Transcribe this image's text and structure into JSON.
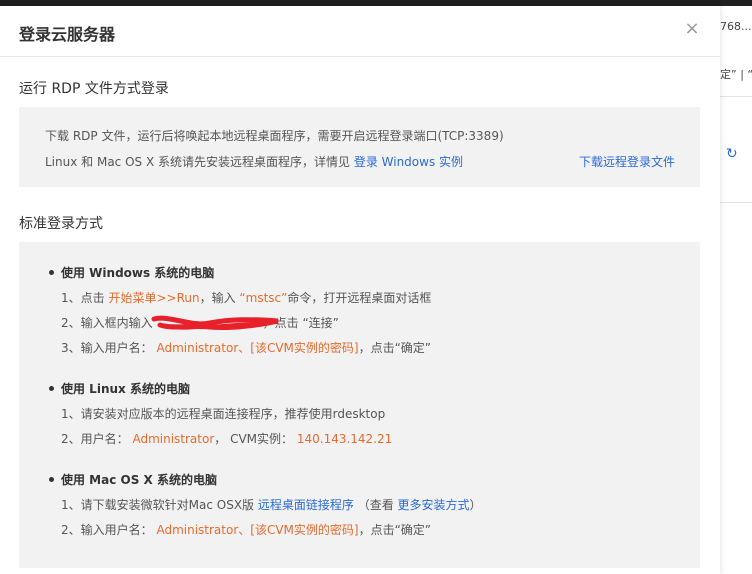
{
  "background": {
    "peek_top": "768...",
    "peek_mid": "定” | “失",
    "refresh_icon": "refresh-icon"
  },
  "modal": {
    "title": "登录云服务器",
    "close_label": "×"
  },
  "rdp": {
    "title": "运行 RDP 文件方式登录",
    "line1": "下载 RDP 文件，运行后将唤起本地远程桌面程序，需要开启远程登录端口(TCP:3389)",
    "line2_prefix": "Linux 和 Mac OS X 系统请先安装远程桌面程序，详情见 ",
    "line2_link": "登录 Windows 实例",
    "download_link": "下载远程登录文件"
  },
  "standard": {
    "title": "标准登录方式",
    "windows": {
      "head": "使用 Windows 系统的电脑",
      "s1_a": "1、点击 ",
      "s1_orange1": "开始菜单>>Run",
      "s1_b": "，输入 ",
      "s1_orange2": "“mstsc”",
      "s1_c": "命令，打开远程桌面对话框",
      "s2_a": "2、输入框内输入",
      "s2_b": "，点击 “连接”",
      "s3_a": "3、输入用户名： ",
      "s3_orange": "Administrator、[该CVM实例的密码]",
      "s3_b": "，点击“确定”"
    },
    "linux": {
      "head": "使用 Linux 系统的电脑",
      "s1": "1、请安装对应版本的远程桌面连接程序，推荐使用rdesktop",
      "s2_a": "2、用户名： ",
      "s2_user": "Administrator",
      "s2_b": "， CVM实例： ",
      "s2_ip": "140.143.142.21"
    },
    "mac": {
      "head": "使用 Mac OS X 系统的电脑",
      "s1_a": "1、请下载安装微软针对Mac OSX版 ",
      "s1_link": "远程桌面链接程序",
      "s1_b": " （查看 ",
      "s1_link2": "更多安装方式",
      "s1_c": "）",
      "s2_a": "2、输入用户名： ",
      "s2_orange": "Administrator、[该CVM实例的密码]",
      "s2_b": "，点击“确定”"
    }
  },
  "colors": {
    "link": "#2a6ad8",
    "highlight": "#e56b2d",
    "redaction": "#e8202a"
  }
}
